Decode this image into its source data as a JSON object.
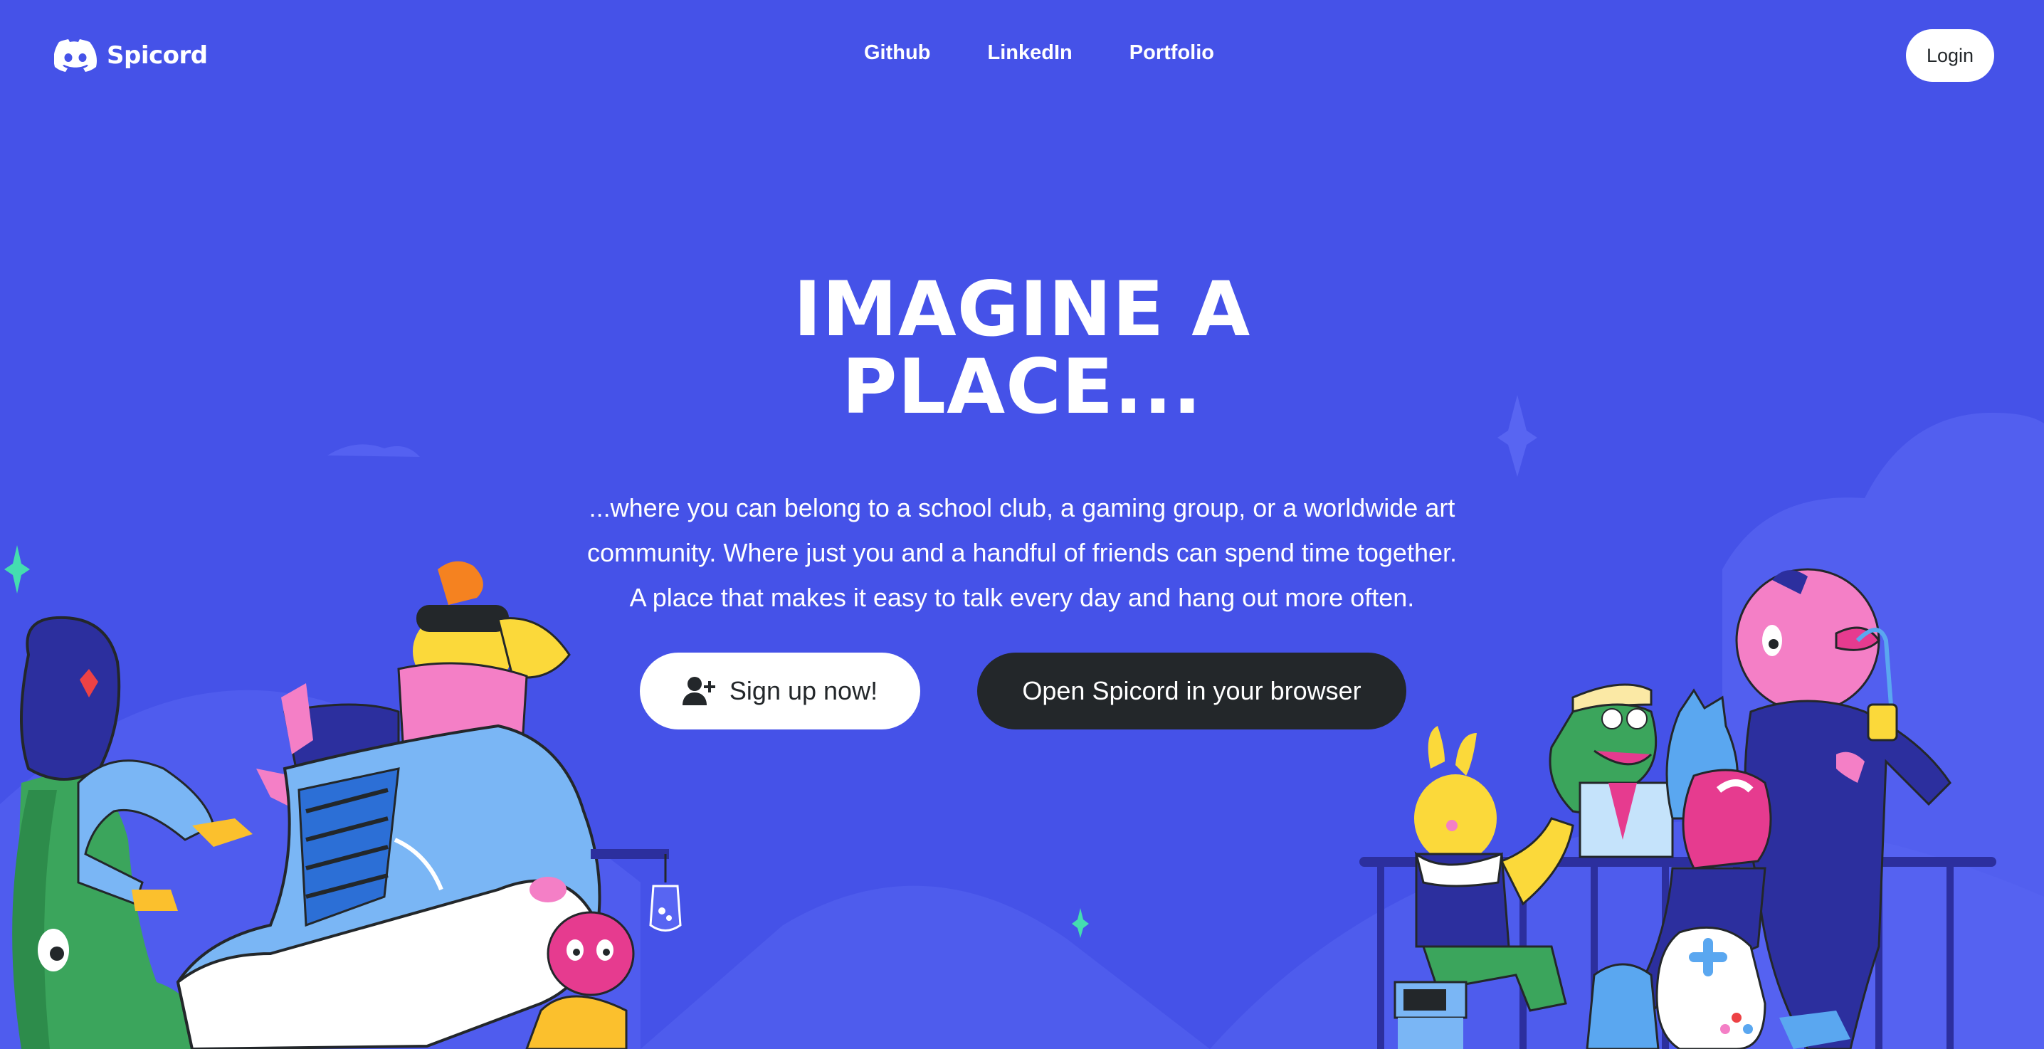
{
  "brand": {
    "name": "Spicord",
    "logo_icon": "discord-controller-logo"
  },
  "nav": {
    "links": [
      "Github",
      "LinkedIn",
      "Portfolio"
    ]
  },
  "header": {
    "login_label": "Login"
  },
  "hero": {
    "title_line1": "IMAGINE A",
    "title_line2": "PLACE...",
    "subtitle_line1": "...where you can belong to a school club, a gaming group, or a worldwide art",
    "subtitle_line2": "community. Where just you and a handful of friends can spend time together.",
    "subtitle_line3": "A place that makes it easy to talk every day and hang out more often.",
    "signup_label": "Sign up now!",
    "signup_icon": "add-user-icon",
    "browser_label": "Open Spicord in your browser"
  },
  "colors": {
    "background": "#4552e8",
    "dark_button": "#23272a",
    "white": "#ffffff"
  }
}
